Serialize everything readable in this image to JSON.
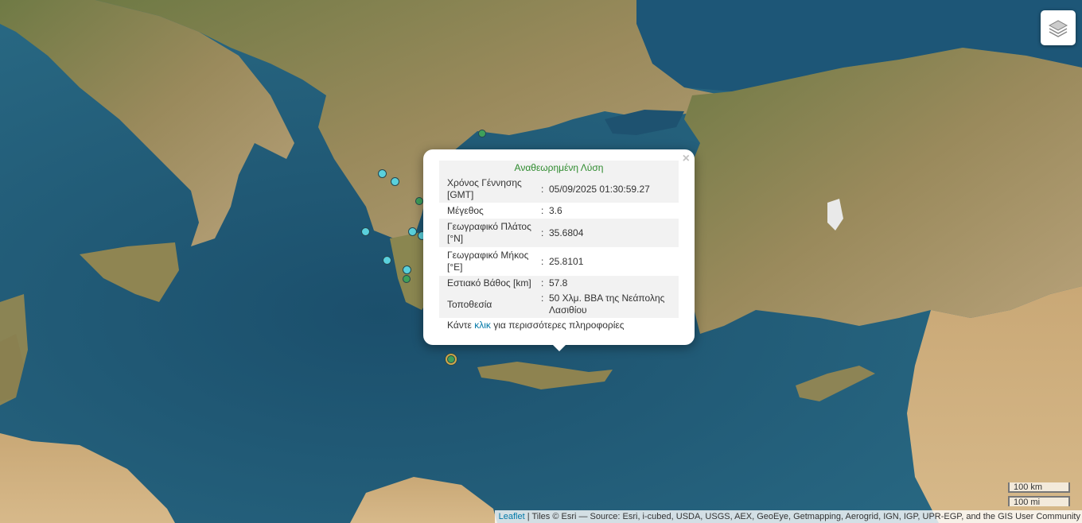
{
  "map": {
    "colors": {
      "sea": "#1f5a78",
      "land": "#8c8253",
      "marker_recent": "#5ad0dc",
      "marker_old": "#3fa05a",
      "marker_selected": "#d2a84a"
    },
    "markers": [
      {
        "name": "epicenter-marker",
        "state": "recent"
      },
      {
        "name": "epicenter-marker",
        "state": "recent"
      },
      {
        "name": "epicenter-marker",
        "state": "recent"
      },
      {
        "name": "epicenter-marker",
        "state": "recent"
      },
      {
        "name": "epicenter-marker",
        "state": "recent"
      },
      {
        "name": "epicenter-marker",
        "state": "recent"
      },
      {
        "name": "epicenter-marker",
        "state": "recent"
      },
      {
        "name": "epicenter-marker",
        "state": "old"
      },
      {
        "name": "epicenter-marker",
        "state": "old"
      },
      {
        "name": "epicenter-marker",
        "state": "old"
      },
      {
        "name": "selected-epicenter-marker",
        "state": "selected"
      }
    ]
  },
  "layers_control": {
    "icon": "layers-icon"
  },
  "popup": {
    "title": "Αναθεωρημένη Λύση",
    "close": "×",
    "rows": [
      {
        "label": "Χρόνος Γέννησης [GMT]",
        "value": "05/09/2025 01:30:59.27"
      },
      {
        "label": "Μέγεθος",
        "value": "3.6"
      },
      {
        "label": "Γεωγραφικό Πλάτος [°N]",
        "value": "35.6804"
      },
      {
        "label": "Γεωγραφικό Μήκος [°E]",
        "value": "25.8101"
      },
      {
        "label": "Εστιακό Βάθος [km]",
        "value": "57.8"
      },
      {
        "label": "Τοποθεσία",
        "value": "50 Χλμ. ΒΒΑ της Νεάπολης Λασιθίου"
      }
    ],
    "colon": ":",
    "more_prefix": "Κάντε",
    "more_link": "κλικ",
    "more_suffix": "για περισσότερες πληροφορίες"
  },
  "scale": {
    "km": "100 km",
    "mi": "100 mi"
  },
  "attribution": {
    "leaflet": "Leaflet",
    "text": " | Tiles © Esri — Source: Esri, i-cubed, USDA, USGS, AEX, GeoEye, Getmapping, Aerogrid, IGN, IGP, UPR-EGP, and the GIS User Community"
  }
}
